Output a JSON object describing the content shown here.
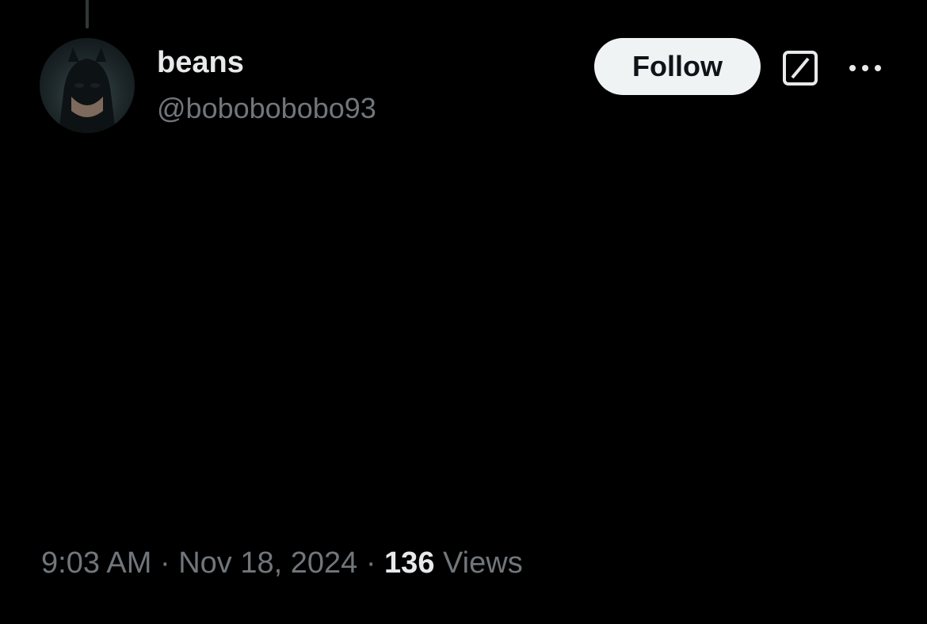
{
  "author": {
    "display_name": "beans",
    "handle": "@bobobobobo93",
    "avatar_icon": "avatar-photo"
  },
  "actions": {
    "follow_label": "Follow",
    "grok_icon": "grok-icon",
    "more_icon": "more-options-icon"
  },
  "tweet": {
    "text": ""
  },
  "meta": {
    "time": "9:03 AM",
    "separator": "·",
    "date": "Nov 18, 2024",
    "views_count": "136",
    "views_label": "Views"
  },
  "colors": {
    "background": "#000000",
    "primary_text": "#e7e9ea",
    "secondary_text": "#71767b",
    "follow_bg": "#eff3f4",
    "follow_text": "#0f1419"
  }
}
